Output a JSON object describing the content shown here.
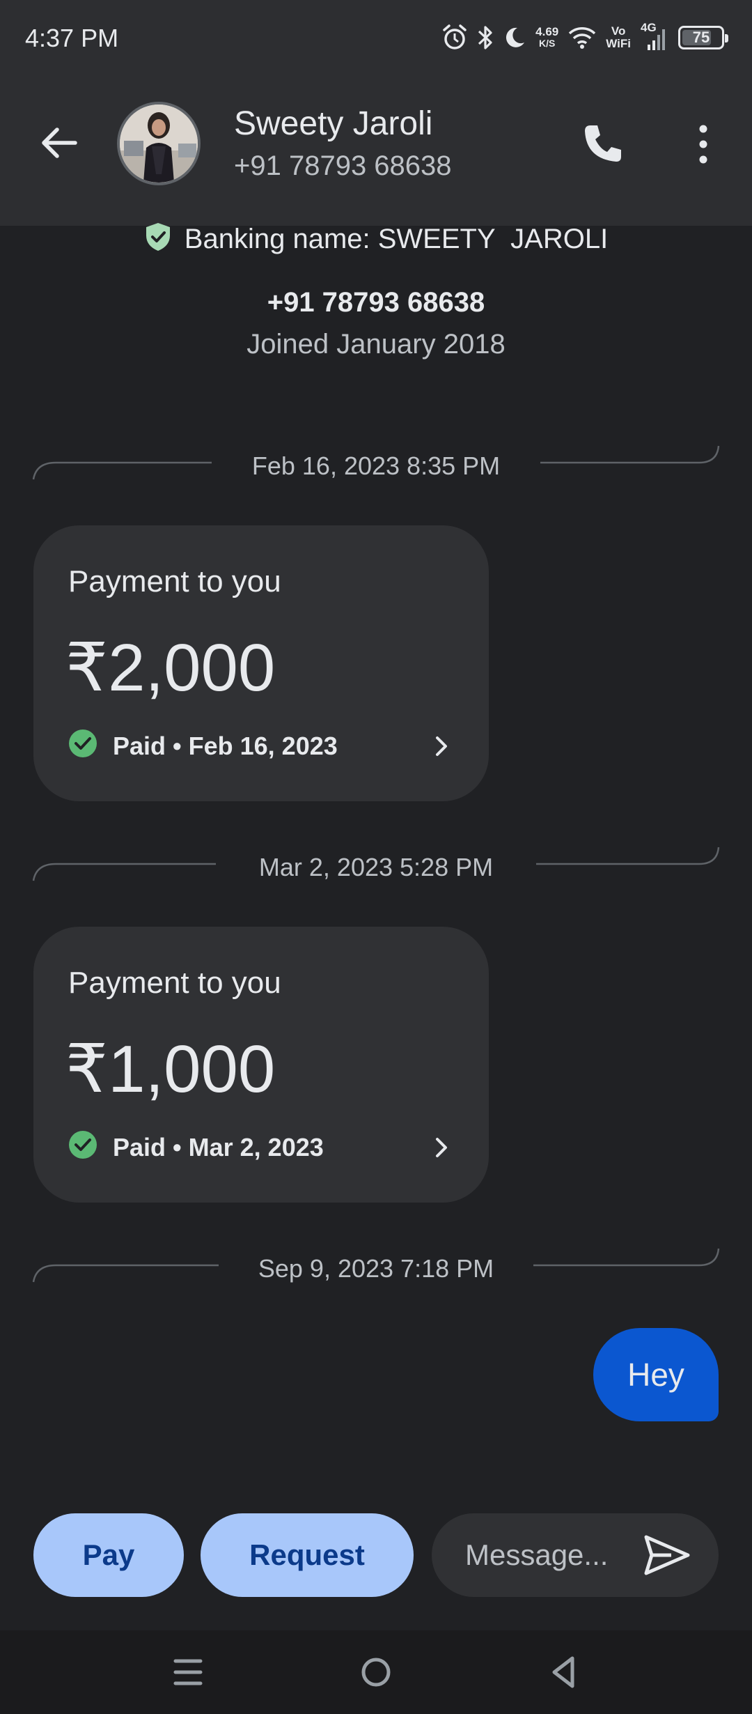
{
  "status_bar": {
    "time": "4:37 PM",
    "net_speed_value": "4.69",
    "net_speed_unit": "K/S",
    "vowifi_top": "Vo",
    "vowifi_bottom": "WiFi",
    "network_type": "4G",
    "battery_level": "75",
    "battery_fraction": 0.75,
    "icons": [
      "alarm-icon",
      "bluetooth-icon",
      "dnd-moon-icon",
      "wifi-icon",
      "signal-icon",
      "battery-icon"
    ]
  },
  "header": {
    "contact_name": "Sweety Jaroli",
    "contact_phone": "+91 78793 68638",
    "icons": [
      "back-arrow-icon",
      "phone-icon",
      "more-vert-icon"
    ]
  },
  "profile": {
    "banking_name": "Banking name: SWEETY  JAROLI",
    "phone": "+91 78793 68638",
    "joined": "Joined January 2018"
  },
  "timeline": {
    "separators": [
      "Feb 16, 2023 8:35 PM",
      "Mar 2, 2023 5:28 PM",
      "Sep 9, 2023 7:18 PM"
    ],
    "payments": [
      {
        "title": "Payment to you",
        "amount": "₹2,000",
        "status": "Paid • Feb 16, 2023"
      },
      {
        "title": "Payment to you",
        "amount": "₹1,000",
        "status": "Paid • Mar 2, 2023"
      }
    ],
    "sent_message": "Hey"
  },
  "actions": {
    "pay_label": "Pay",
    "request_label": "Request",
    "message_placeholder": "Message..."
  },
  "colors": {
    "background": "#202124",
    "header_bg": "#2d2e31",
    "card_bg": "#303134",
    "sent_bubble": "#0b57d0",
    "action_button": "#a8c7fa",
    "success_green": "#5bb974"
  }
}
